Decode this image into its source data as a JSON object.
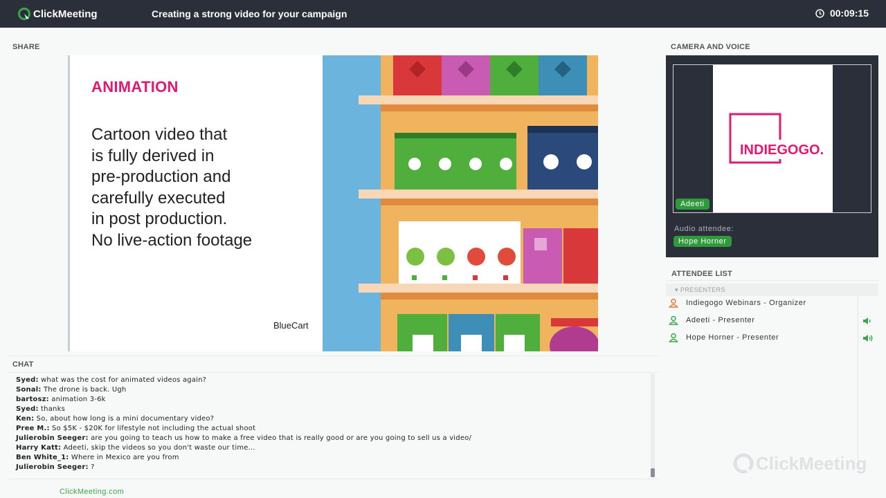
{
  "app": {
    "brand": "ClickMeeting",
    "title": "Creating a strong video for your campaign",
    "timer": "00:09:15"
  },
  "share": {
    "label": "SHARE",
    "slide": {
      "heading": "ANIMATION",
      "body_lines": [
        "Cartoon video that",
        "is fully derived in",
        "pre-production and",
        "carefully executed",
        "in post production.",
        "No live-action footage"
      ],
      "credit": "BlueCart"
    }
  },
  "camera": {
    "label": "CAMERA AND VOICE",
    "video_logo": "INDIEGOGO.",
    "speaker_badge": "Adeeti",
    "audio_label": "Audio attendee:",
    "audio_badge": "Hope Horner"
  },
  "attendees": {
    "label": "ATTENDEE LIST",
    "group": "PRESENTERS",
    "items": [
      {
        "text": "Indiegogo Webinars - Organizer",
        "color": "#e2772f",
        "speaker": ""
      },
      {
        "text": "Adeeti - Presenter",
        "color": "#3aa64b",
        "speaker": "low"
      },
      {
        "text": "Hope Horner - Presenter",
        "color": "#3aa64b",
        "speaker": "high"
      }
    ]
  },
  "chat": {
    "label": "CHAT",
    "messages": [
      {
        "name": "Syed:",
        "text": " what was the cost for animated videos again?"
      },
      {
        "name": "Sonal:",
        "text": " The drone is back. Ugh"
      },
      {
        "name": "bartosz:",
        "text": " animation 3-6k"
      },
      {
        "name": "Syed:",
        "text": " thanks"
      },
      {
        "name": "Ken:",
        "text": " So, about how long is a mini documentary video?"
      },
      {
        "name": "Pree M.:",
        "text": " So $5K - $20K for lifestyle not including the actual shoot"
      },
      {
        "name": "Julierobin Seeger:",
        "text": " are you going to teach us how to make a free video that is really good or are you going to sell us a video/"
      },
      {
        "name": "Harry Katt:",
        "text": " Adeeti, skip the videos so you don't waste our time..."
      },
      {
        "name": "Ben White_1:",
        "text": " Where in Mexico are you from"
      },
      {
        "name": "Julierobin Seeger:",
        "text": " ?"
      }
    ]
  },
  "footer": {
    "link": "ClickMeeting.com"
  },
  "colors": {
    "topbar": "#2b2f3a",
    "accent_green": "#3aa64b",
    "brand_pink": "#e5176f"
  }
}
